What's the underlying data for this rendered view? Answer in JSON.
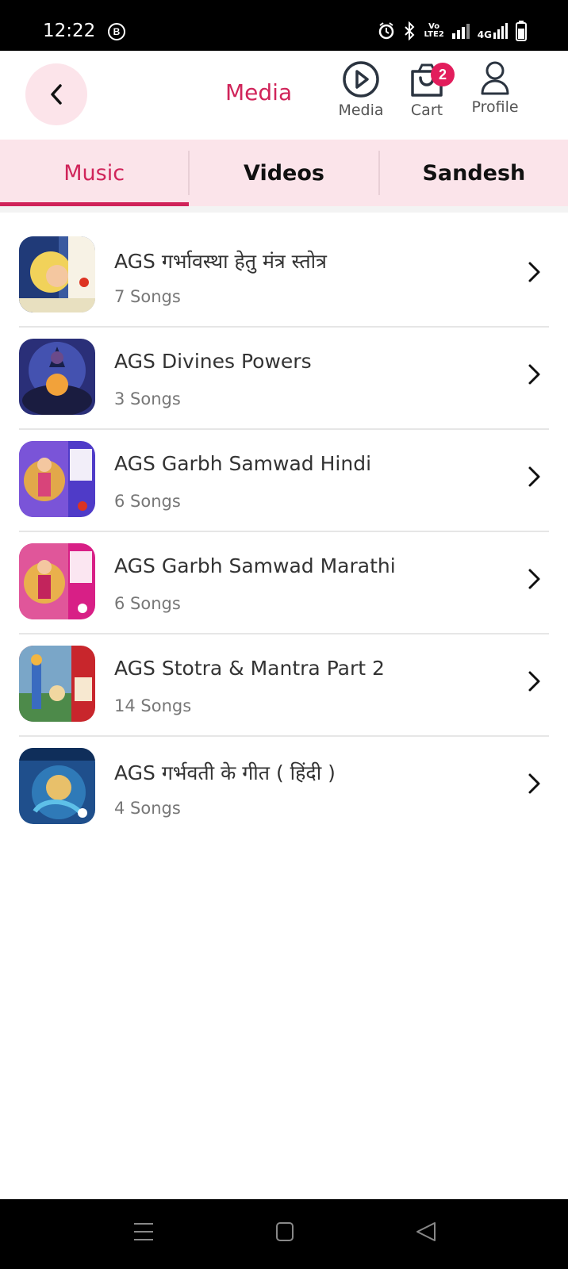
{
  "status": {
    "time": "12:22",
    "b_icon": "B",
    "net_top": "Vo",
    "net_bottom": "LTE2",
    "net_4g": "4G"
  },
  "header": {
    "title": "Media",
    "media_label": "Media",
    "cart_label": "Cart",
    "cart_count": "2",
    "profile_label": "Profile"
  },
  "tabs": [
    {
      "label": "Music",
      "active": true
    },
    {
      "label": "Videos",
      "active": false
    },
    {
      "label": "Sandesh",
      "active": false
    }
  ],
  "albums": [
    {
      "title": "AGS  गर्भावस्था हेतु  मंत्र स्तोत्र",
      "count": "7 Songs"
    },
    {
      "title": "AGS Divines Powers",
      "count": "3 Songs"
    },
    {
      "title": "AGS Garbh Samwad Hindi",
      "count": "6 Songs"
    },
    {
      "title": "AGS Garbh Samwad Marathi",
      "count": "6 Songs"
    },
    {
      "title": "AGS Stotra & Mantra Part 2",
      "count": "14 Songs"
    },
    {
      "title": "AGS गर्भवती के गीत  ( हिंदी )",
      "count": "4 Songs"
    }
  ],
  "colors": {
    "accent": "#d0245a",
    "tab_bg": "#fbe4ea",
    "badge": "#e21d5c"
  }
}
